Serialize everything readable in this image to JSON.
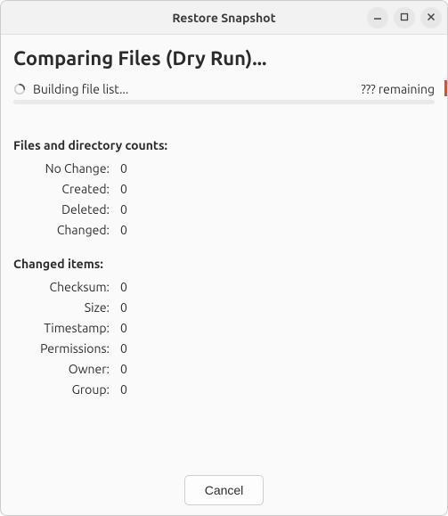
{
  "window": {
    "title": "Restore Snapshot"
  },
  "header": {
    "title": "Comparing Files (Dry Run)..."
  },
  "status": {
    "text": "Building file list...",
    "remaining": "??? remaining"
  },
  "sections": {
    "counts": {
      "title": "Files and directory counts:",
      "items": [
        {
          "label": "No Change:",
          "value": "0"
        },
        {
          "label": "Created:",
          "value": "0"
        },
        {
          "label": "Deleted:",
          "value": "0"
        },
        {
          "label": "Changed:",
          "value": "0"
        }
      ]
    },
    "changed": {
      "title": "Changed items:",
      "items": [
        {
          "label": "Checksum:",
          "value": "0"
        },
        {
          "label": "Size:",
          "value": "0"
        },
        {
          "label": "Timestamp:",
          "value": "0"
        },
        {
          "label": "Permissions:",
          "value": "0"
        },
        {
          "label": "Owner:",
          "value": "0"
        },
        {
          "label": "Group:",
          "value": "0"
        }
      ]
    }
  },
  "footer": {
    "cancel_label": "Cancel"
  }
}
